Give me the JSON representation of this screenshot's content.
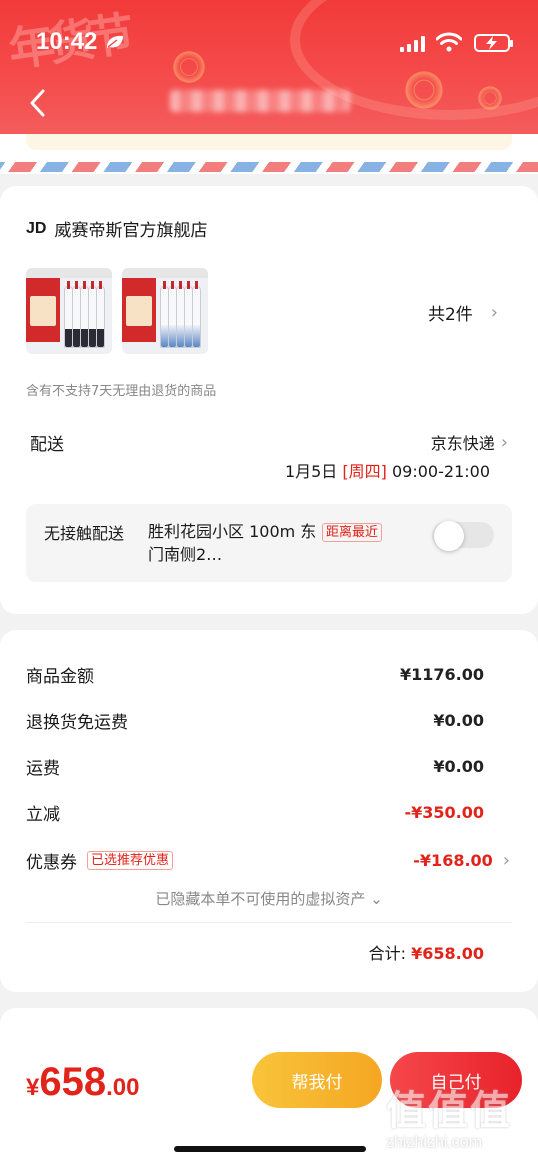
{
  "status_bar": {
    "time": "10:42"
  },
  "header": {
    "deco_text": "年货节"
  },
  "store": {
    "logo": "JD",
    "name": "威赛帝斯官方旗舰店",
    "item_count_text": "共2件",
    "return_note": "含有不支持7天无理由退货的商品"
  },
  "shipping": {
    "label": "配送",
    "carrier": "京东快递",
    "date": "1月5日",
    "weekday": "[周四]",
    "time_window": "09:00-21:00",
    "contactless_label": "无接触配送",
    "location": "胜利花园小区 100m 东门南侧2…",
    "distance_tag": "距离最近",
    "contactless_enabled": 0
  },
  "summary": {
    "rows": [
      {
        "label": "商品金额",
        "value": "¥1176.00"
      },
      {
        "label": "退换货免运费",
        "value": "¥0.00"
      },
      {
        "label": "运费",
        "value": "¥0.00"
      },
      {
        "label": "立减",
        "value": "-¥350.00"
      }
    ],
    "coupon": {
      "label": "优惠券",
      "tag": "已选推荐优惠",
      "value": "-¥168.00"
    },
    "hidden_note": "已隐藏本单不可使用的虚拟资产",
    "total_label": "合计:",
    "total_value": "¥658.00"
  },
  "footer": {
    "currency": "¥",
    "amount_int": "658",
    "amount_dec": ".00",
    "help_pay_button": "帮我付",
    "self_pay_button": "自己付"
  },
  "watermark": {
    "glyphs": "值值值",
    "url": "zhizhizhi.com"
  },
  "colors": {
    "brand_red": "#e2231a",
    "help_button": "#f5a623",
    "self_button": "#e8222a",
    "header": "#f23a3a"
  }
}
